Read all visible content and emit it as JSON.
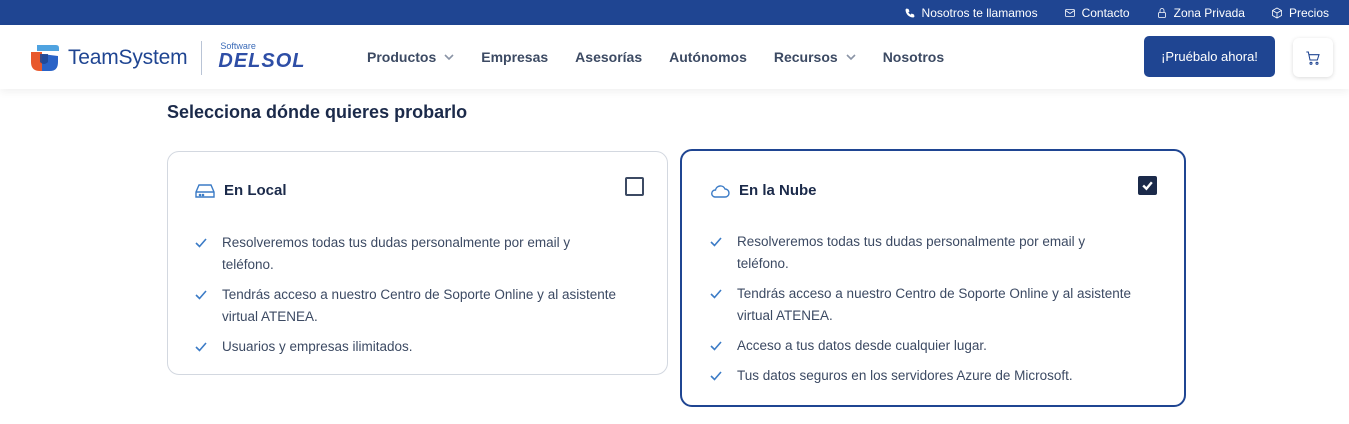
{
  "topbar": {
    "items": [
      {
        "label": "Nosotros te llamamos",
        "icon": "phone-icon"
      },
      {
        "label": "Contacto",
        "icon": "mail-icon"
      },
      {
        "label": "Zona Privada",
        "icon": "lock-icon"
      },
      {
        "label": "Precios",
        "icon": "box-icon"
      }
    ]
  },
  "header": {
    "logo_text": "TeamSystem",
    "brand_small": "Software",
    "brand_word": "DELSOL",
    "nav": [
      {
        "label": "Productos",
        "dropdown": true
      },
      {
        "label": "Empresas",
        "dropdown": false
      },
      {
        "label": "Asesorías",
        "dropdown": false
      },
      {
        "label": "Autónomos",
        "dropdown": false
      },
      {
        "label": "Recursos",
        "dropdown": true
      },
      {
        "label": "Nosotros",
        "dropdown": false
      }
    ],
    "cta_label": "¡Pruébalo ahora!",
    "cart_icon": "cart-icon"
  },
  "main": {
    "title": "Selecciona dónde quieres probarlo",
    "options": [
      {
        "title": "En Local",
        "icon": "hard-drive-icon",
        "checked": false,
        "features": [
          "Resolveremos todas tus dudas personalmente por email y teléfono.",
          "Tendrás acceso a nuestro Centro de Soporte Online y al asistente virtual ATENEA.",
          "Usuarios y empresas ilimitados."
        ]
      },
      {
        "title": "En la Nube",
        "icon": "cloud-icon",
        "checked": true,
        "features": [
          "Resolveremos todas tus dudas personalmente por email y teléfono.",
          "Tendrás acceso a nuestro Centro de Soporte Online y al asistente virtual ATENEA.",
          "Acceso a tus datos desde cualquier lugar.",
          "Tus datos seguros en los servidores Azure de Microsoft."
        ]
      }
    ]
  },
  "colors": {
    "brand_blue": "#1f4592",
    "accent_blue": "#3b7bc6",
    "text_dark": "#1b2a4a"
  }
}
